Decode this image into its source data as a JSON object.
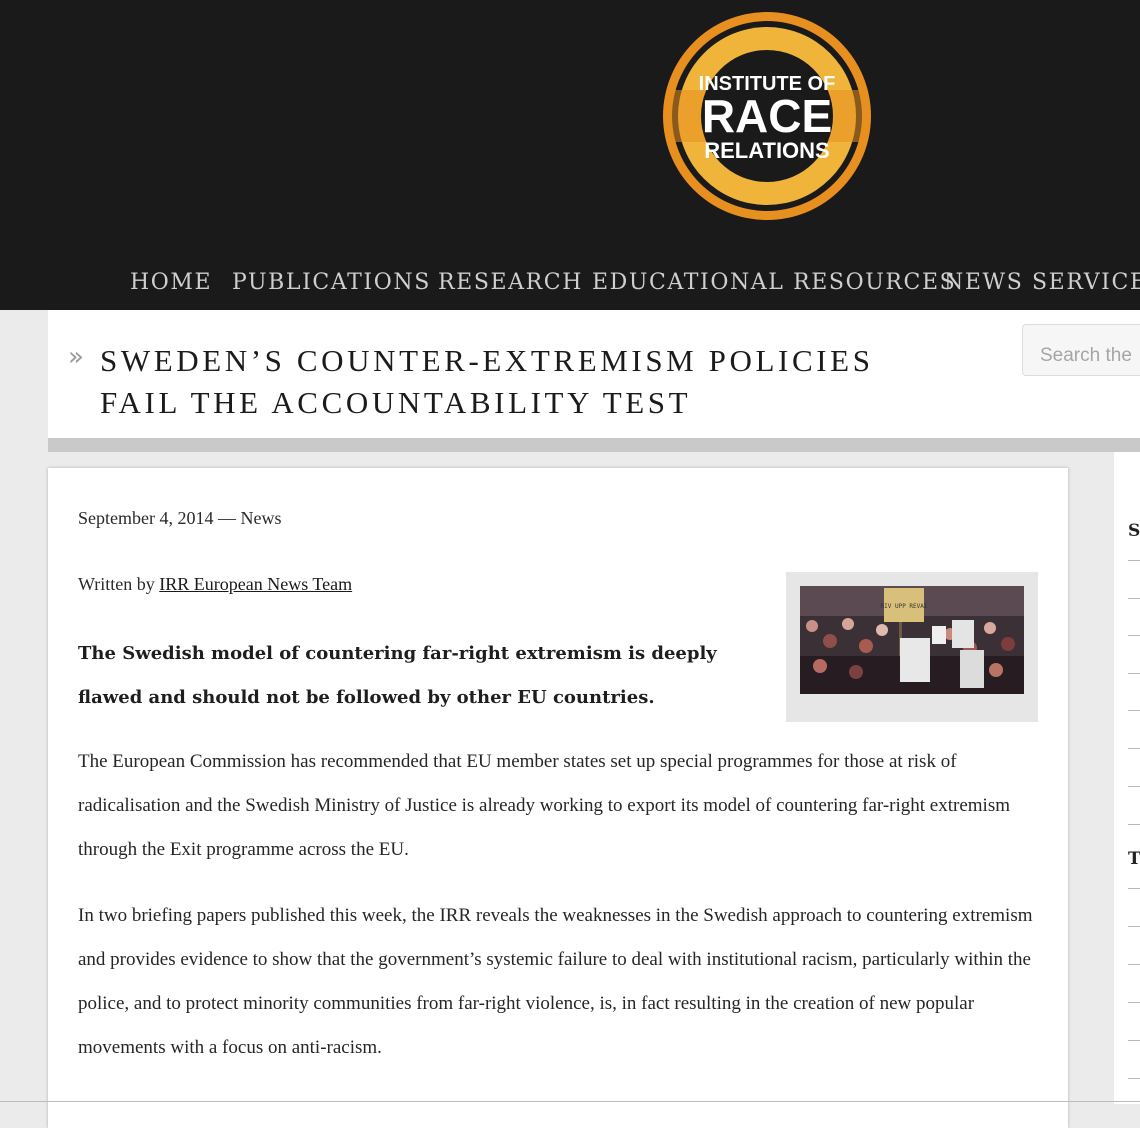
{
  "brand": {
    "logo_lines": [
      "INSTITUTE OF",
      "RACE",
      "RELATIONS"
    ],
    "colors": {
      "header_bg": "#1a1a1a",
      "logo_orange": "#e8901f",
      "logo_gold": "#f0b43a"
    }
  },
  "nav": {
    "items": [
      {
        "label": "HOME"
      },
      {
        "label": "PUBLICATIONS"
      },
      {
        "label": "RESEARCH"
      },
      {
        "label": "EDUCATIONAL RESOURCES"
      },
      {
        "label": "NEWS SERVICE"
      }
    ]
  },
  "title": {
    "chevron": "»",
    "line1": "SWEDEN’S COUNTER-EXTREMISM POLICIES",
    "line2": "FAIL THE ACCOUNTABILITY TEST"
  },
  "search": {
    "placeholder": "Search the"
  },
  "article": {
    "date": "September 4, 2014",
    "separator": " — ",
    "category": "News",
    "byline_prefix": "Written by ",
    "author": "IRR European News Team",
    "lede": "The Swedish model of countering far-right extremism is deeply flawed and should not be followed by other EU countries.",
    "paragraphs": [
      "The European Commission has recommended that EU member states set up special programmes for those at risk of radicalisation and the Swedish Ministry of Justice is already working to export its model of countering far-right extremism through the Exit programme across the EU.",
      "In two briefing papers published this week, the IRR reveals the weaknesses in the Swedish approach to countering extremism and provides evidence to show that the government’s systemic failure to deal with institutional racism, particularly within the police, and to protect minority communities from far-right violence, is, in fact resulting in the creation of new popular movements with a focus on anti-racism."
    ],
    "image": {
      "sign_text": "RIV UPP REVAI"
    }
  },
  "sidebar": {
    "headings": [
      "S",
      "T"
    ]
  }
}
